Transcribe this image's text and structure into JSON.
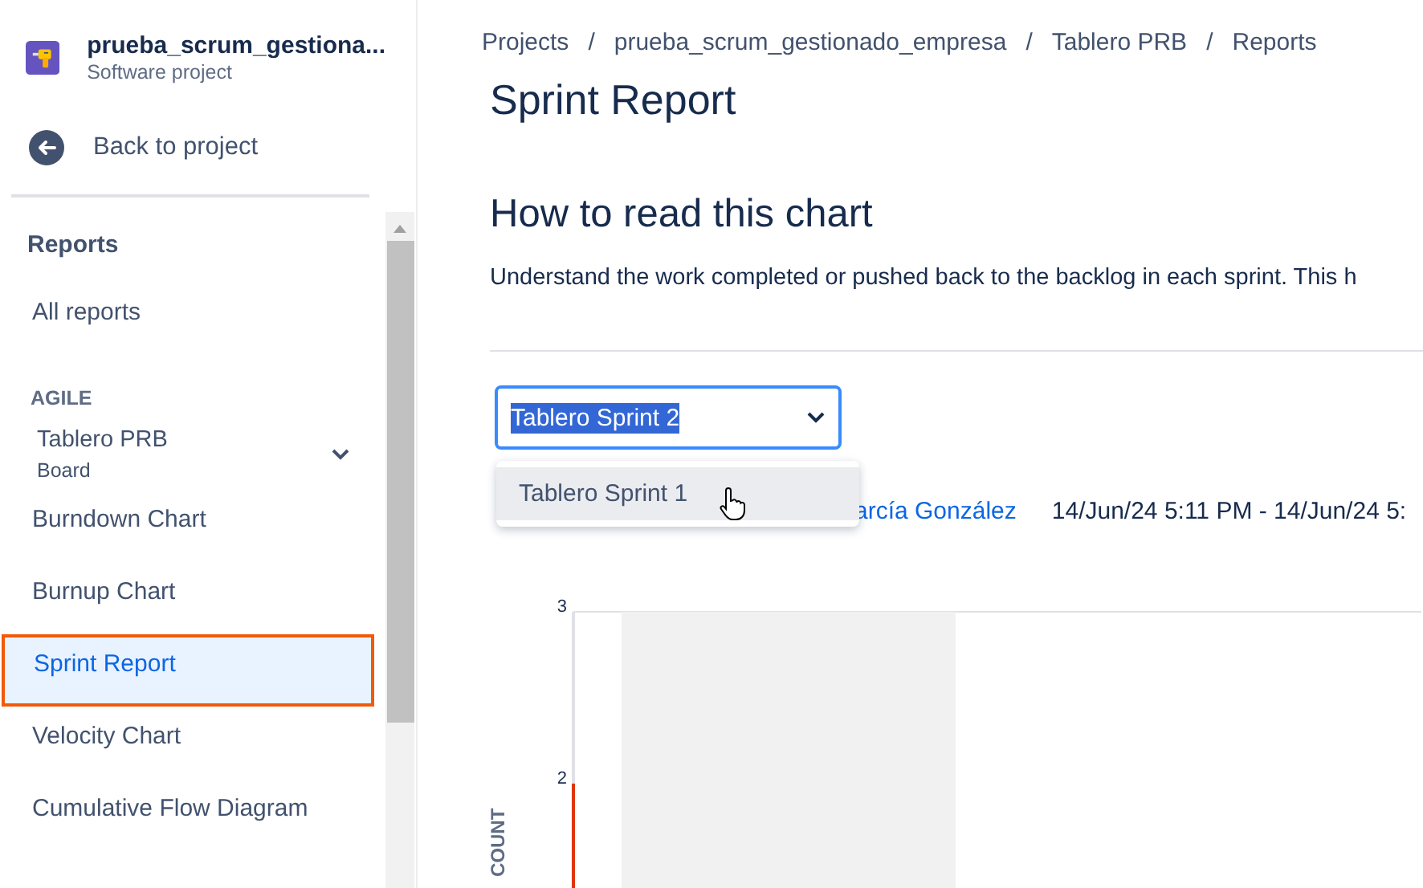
{
  "project": {
    "name": "prueba_scrum_gestiona...",
    "type": "Software project"
  },
  "back_link": "Back to project",
  "sidebar": {
    "heading": "Reports",
    "all_reports": "All reports",
    "section": "AGILE",
    "board": {
      "name": "Tablero PRB",
      "type": "Board",
      "expanded": false
    },
    "items": [
      {
        "label": "Burndown Chart",
        "selected": false
      },
      {
        "label": "Burnup Chart",
        "selected": false
      },
      {
        "label": "Sprint Report",
        "selected": true
      },
      {
        "label": "Velocity Chart",
        "selected": false
      },
      {
        "label": "Cumulative Flow Diagram",
        "selected": false
      }
    ]
  },
  "breadcrumbs": [
    "Projects",
    "prueba_scrum_gestionado_empresa",
    "Tablero PRB",
    "Reports"
  ],
  "breadcrumb_separator": "/",
  "title": "Sprint Report",
  "section_title": "How to read this chart",
  "description": "Understand the work completed or pushed back to the backlog in each sprint. This h",
  "sprint_select": {
    "value": "Tablero Sprint 2",
    "options": [
      {
        "label": "Tablero Sprint 1",
        "selected": false
      }
    ]
  },
  "info": {
    "link_fragment": "arcía González",
    "dates": "14/Jun/24 5:11 PM - 14/Jun/24 5:"
  },
  "chart": {
    "yticks": [
      "3",
      "2"
    ],
    "ylabel": "COUNT"
  }
}
